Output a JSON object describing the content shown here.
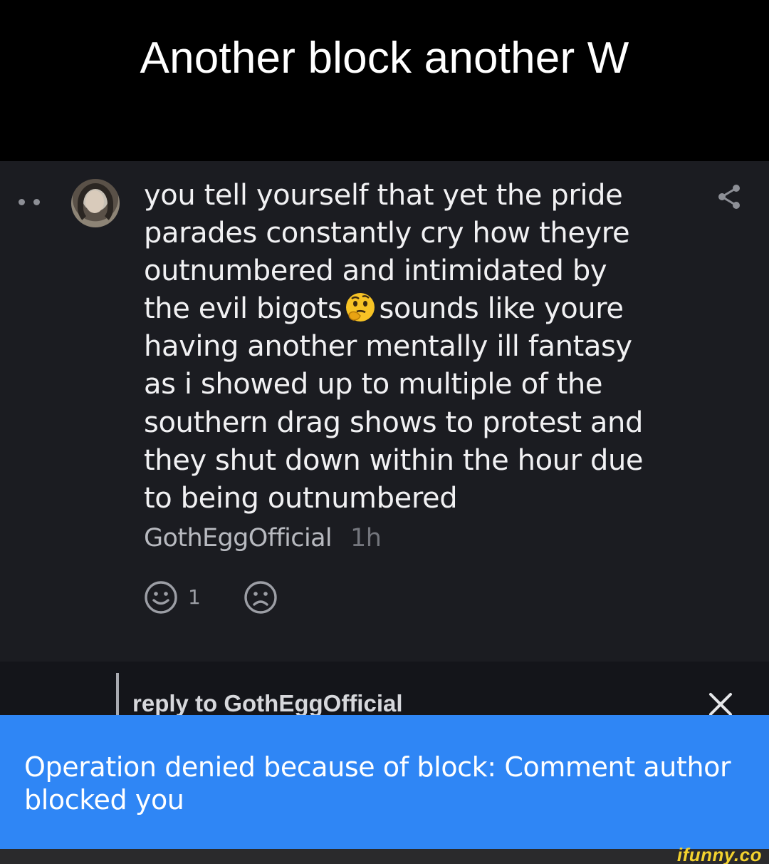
{
  "caption": {
    "title": "Another block another W"
  },
  "comment": {
    "lines": [
      "you tell yourself that yet the pride",
      "parades constantly cry how theyre",
      "outnumbered and intimidated by",
      "the evil bigots",
      "sounds like youre",
      "having another mentally ill fantasy",
      "as i showed up to multiple of the",
      "southern drag shows to protest and",
      "they shut down within the hour due",
      "to being outnumbered"
    ],
    "emoji": "thinking-face",
    "author": "GothEggOfficial",
    "time": "1h",
    "like_count": "1"
  },
  "reply": {
    "label": "reply to GothEggOfficial"
  },
  "toast": {
    "message": "Operation denied because of block: Comment author blocked you"
  },
  "watermark": {
    "text": "ifunny.co"
  },
  "colors": {
    "card_background": "#1b1c21",
    "toast_background": "#2f86f5",
    "watermark": "#f3d22e"
  }
}
